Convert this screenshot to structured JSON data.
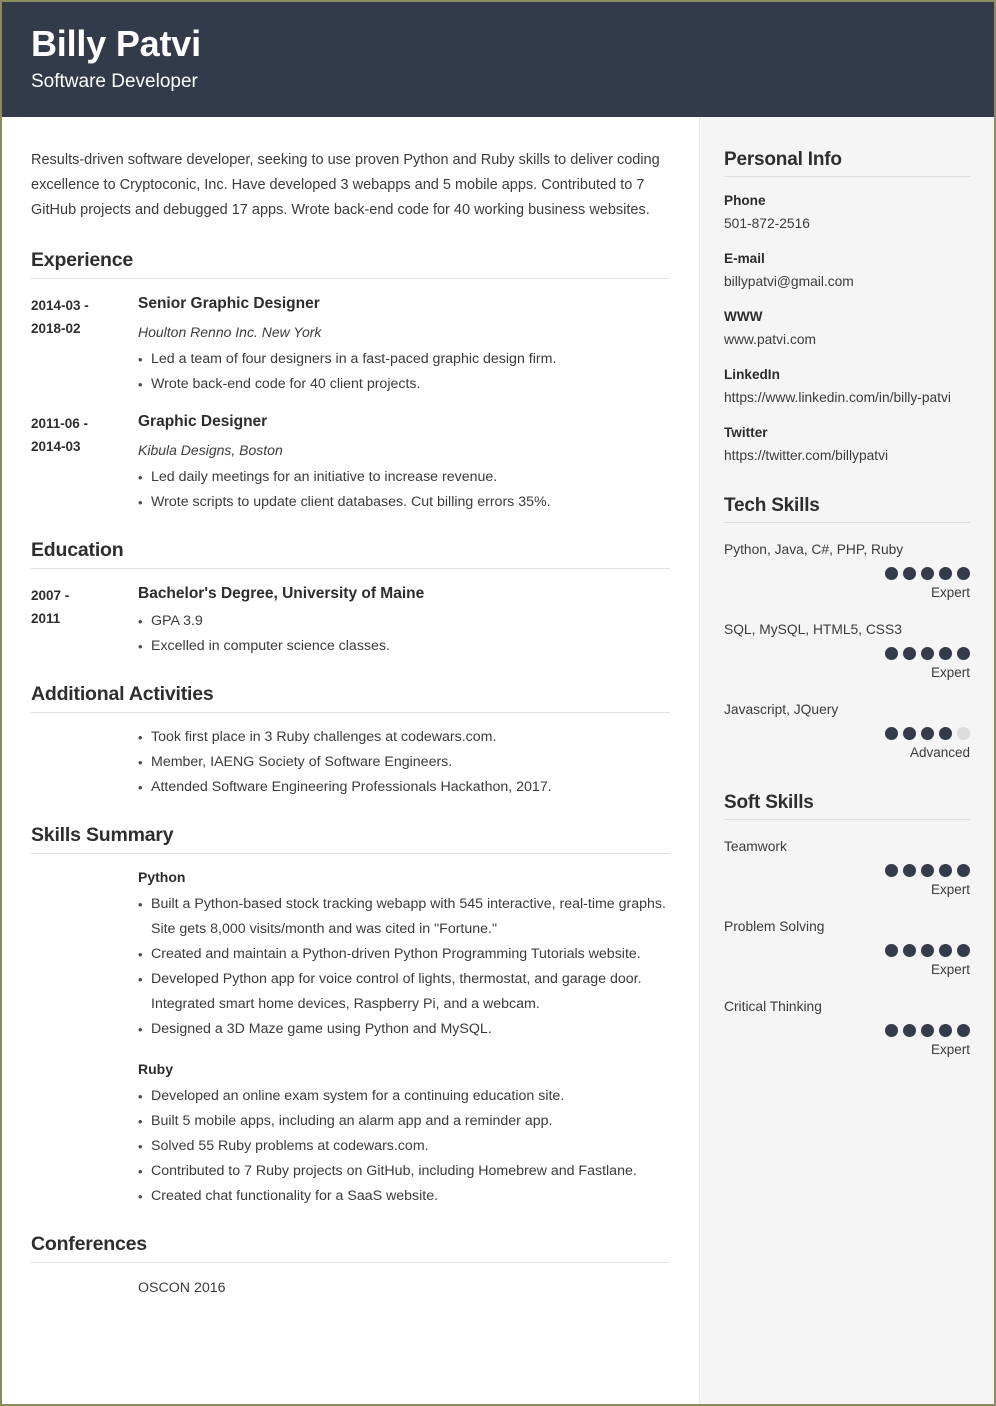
{
  "header": {
    "name": "Billy Patvi",
    "title": "Software Developer",
    "background_color": "#333a49"
  },
  "main": {
    "summary": "Results-driven software developer, seeking to use proven Python and Ruby skills to deliver coding excellence to Cryptoconic, Inc. Have developed 3 webapps and 5 mobile apps. Contributed to 7 GitHub projects and debugged 17 apps. Wrote back-end code for 40 working business websites.",
    "sections": {
      "experience": {
        "title": "Experience",
        "entries": [
          {
            "date": "2014-03 - 2018-02",
            "date_line1": "2014-03 -",
            "date_line2": "2018-02",
            "role": "Senior Graphic Designer",
            "company": "Houlton Renno Inc. New York",
            "bullets": [
              "Led a team of four designers in a fast-paced graphic design firm.",
              "Wrote back-end code for 40 client projects."
            ]
          },
          {
            "date": "2011-06 - 2014-03",
            "date_line1": "2011-06 -",
            "date_line2": "2014-03",
            "role": "Graphic Designer",
            "company": "Kibula Designs, Boston",
            "bullets": [
              "Led daily meetings for an initiative to increase revenue.",
              "Wrote scripts to update client databases. Cut billing errors 35%."
            ]
          }
        ]
      },
      "education": {
        "title": "Education",
        "entries": [
          {
            "date_line1": "2007 -",
            "date_line2": "2011",
            "degree": "Bachelor's Degree, University of Maine",
            "bullets": [
              "GPA 3.9",
              "Excelled in computer science classes."
            ]
          }
        ]
      },
      "activities": {
        "title": "Additional Activities",
        "bullets": [
          "Took first place in 3 Ruby challenges at codewars.com.",
          "Member, IAENG Society of Software Engineers.",
          "Attended Software Engineering Professionals Hackathon, 2017."
        ]
      },
      "skills_summary": {
        "title": "Skills Summary",
        "groups": [
          {
            "name": "Python",
            "bullets": [
              "Built a Python-based stock tracking webapp with 545 interactive, real-time graphs. Site gets 8,000 visits/month and was cited in \"Fortune.\"",
              "Created and maintain a Python-driven Python Programming Tutorials website.",
              "Developed Python app for voice control of lights, thermostat, and garage door. Integrated smart home devices, Raspberry Pi, and a webcam.",
              "Designed a 3D Maze game using Python and MySQL."
            ]
          },
          {
            "name": "Ruby",
            "bullets": [
              "Developed an online exam system for a continuing education site.",
              "Built 5 mobile apps, including an alarm app and a reminder app.",
              "Solved 55 Ruby problems at codewars.com.",
              "Contributed to 7 Ruby projects on GitHub, including Homebrew and Fastlane.",
              "Created chat functionality for a SaaS website."
            ]
          }
        ]
      },
      "conferences": {
        "title": "Conferences",
        "items": [
          "OSCON 2016"
        ]
      }
    }
  },
  "sidebar": {
    "personal_info": {
      "title": "Personal Info",
      "items": [
        {
          "label": "Phone",
          "value": "501-872-2516"
        },
        {
          "label": "E-mail",
          "value": "billypatvi@gmail.com"
        },
        {
          "label": "WWW",
          "value": "www.patvi.com"
        },
        {
          "label": "LinkedIn",
          "value": "https://www.linkedin.com/in/billy-patvi"
        },
        {
          "label": "Twitter",
          "value": "https://twitter.com/billypatvi"
        }
      ]
    },
    "tech_skills": {
      "title": "Tech Skills",
      "items": [
        {
          "name": "Python, Java, C#, PHP, Ruby",
          "rating": 5,
          "max": 5,
          "level": "Expert"
        },
        {
          "name": "SQL, MySQL, HTML5, CSS3",
          "rating": 5,
          "max": 5,
          "level": "Expert"
        },
        {
          "name": "Javascript, JQuery",
          "rating": 4,
          "max": 5,
          "level": "Advanced"
        }
      ]
    },
    "soft_skills": {
      "title": "Soft Skills",
      "items": [
        {
          "name": "Teamwork",
          "rating": 5,
          "max": 5,
          "level": "Expert"
        },
        {
          "name": "Problem Solving",
          "rating": 5,
          "max": 5,
          "level": "Expert"
        },
        {
          "name": "Critical Thinking",
          "rating": 5,
          "max": 5,
          "level": "Expert"
        }
      ]
    },
    "dot_filled_color": "#343b4a",
    "dot_empty_color": "#dcdcdc",
    "background_color": "#f5f5f5"
  }
}
